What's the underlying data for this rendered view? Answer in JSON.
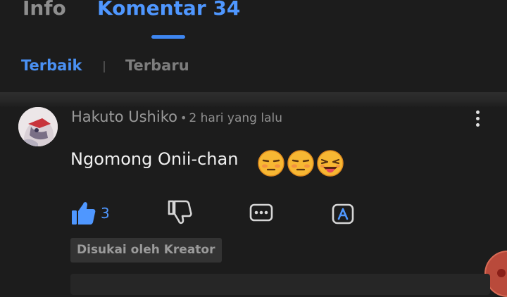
{
  "tabs": {
    "info": "Info",
    "comments": "Komentar 34"
  },
  "filters": {
    "best": "Terbaik",
    "newest": "Terbaru"
  },
  "comment": {
    "author": "Hakuto Ushiko",
    "separator": "•",
    "time": "2 hari yang lalu",
    "text": "Ngomong Onii-chan",
    "emojis": [
      "unamused-face-emoji",
      "unamused-face-emoji",
      "smirking-tongue-emoji"
    ],
    "like_count": "3",
    "creator_badge": "Disukai oleh Kreator"
  },
  "colors": {
    "accent": "#4f97ff",
    "background": "#1c1c1c",
    "muted_text": "#9a9a9a"
  },
  "icons": [
    "thumbs-up-icon",
    "thumbs-down-icon",
    "reply-bubble-icon",
    "translate-icon",
    "more-vertical-icon"
  ]
}
